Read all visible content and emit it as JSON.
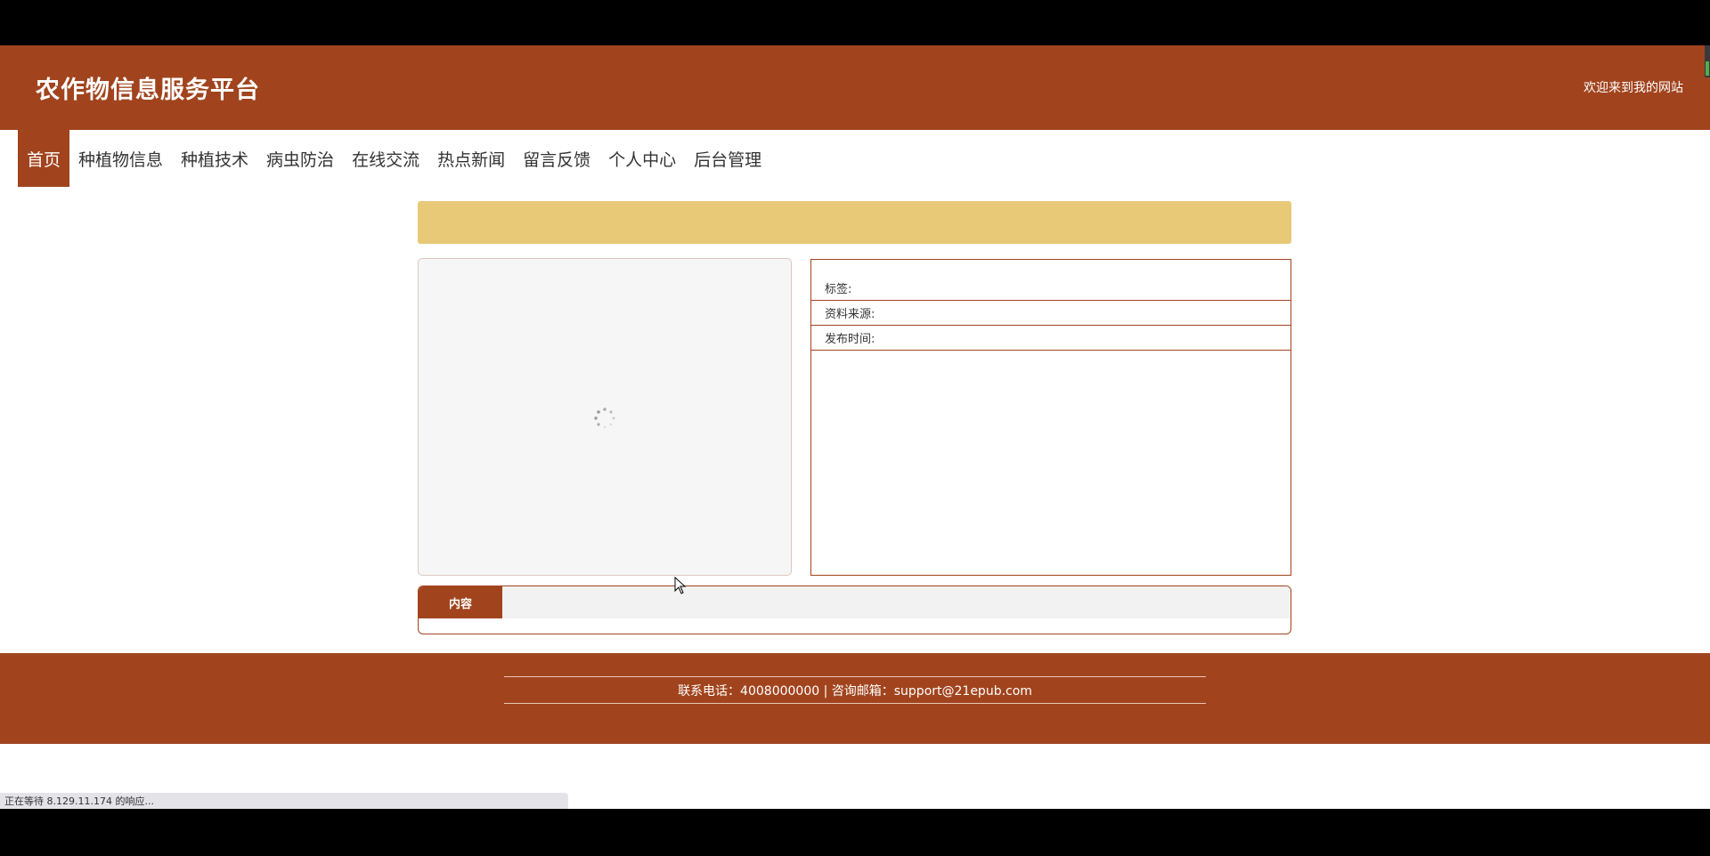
{
  "header": {
    "title": "农作物信息服务平台",
    "welcome": "欢迎来到我的网站"
  },
  "nav": {
    "items": [
      {
        "label": "首页",
        "active": true
      },
      {
        "label": "种植物信息"
      },
      {
        "label": "种植技术"
      },
      {
        "label": "病虫防治"
      },
      {
        "label": "在线交流"
      },
      {
        "label": "热点新闻"
      },
      {
        "label": "留言反馈"
      },
      {
        "label": "个人中心"
      },
      {
        "label": "后台管理"
      }
    ]
  },
  "details": {
    "tags_label": "标签:",
    "source_label": "资料来源:",
    "published_label": "发布时间:"
  },
  "content": {
    "tab_label": "内容"
  },
  "footer": {
    "contact": "联系电话：4008000000 | 咨询邮箱：support@21epub.com"
  },
  "status": {
    "text": "正在等待 8.129.11.174 的响应..."
  },
  "colors": {
    "primary": "#a1441e",
    "banner": "#e8c978"
  },
  "icons": [
    "loading-spinner-icon",
    "mouse-cursor-icon"
  ]
}
